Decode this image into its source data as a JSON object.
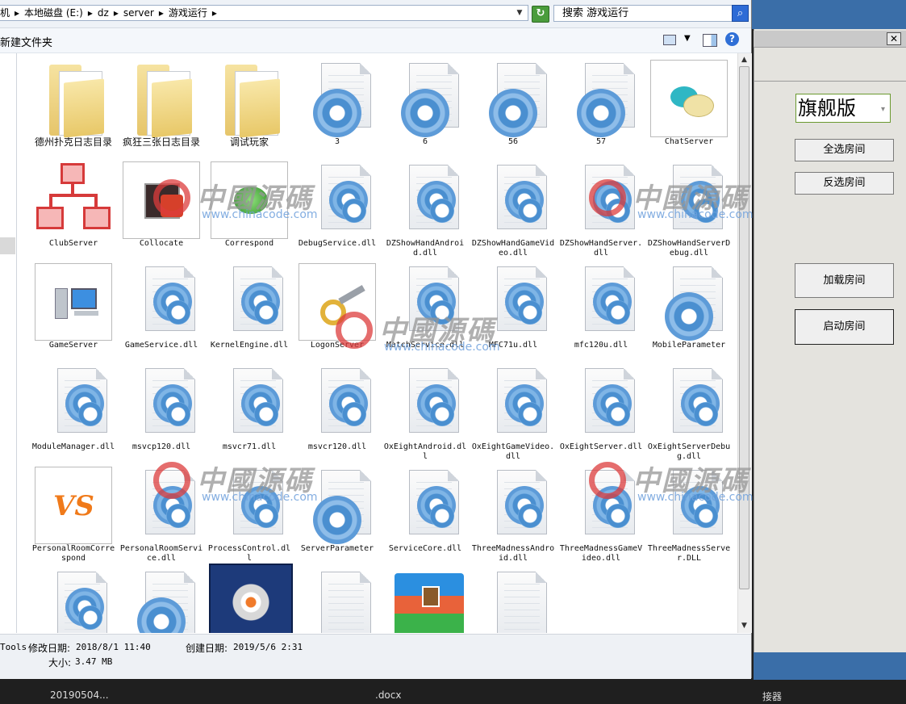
{
  "address_bar": {
    "segments": [
      "机",
      "▸",
      "本地磁盘 (E:)",
      "▸",
      "dz",
      "▸",
      "server",
      "▸",
      "游戏运行",
      "▸"
    ],
    "search_placeholder": "搜索 游戏运行"
  },
  "toolbar": {
    "new_folder_label": "新建文件夹"
  },
  "files": [
    {
      "name": "德州扑克日志目录",
      "type": "folder"
    },
    {
      "name": "疯狂三张日志目录",
      "type": "folder"
    },
    {
      "name": "调试玩家",
      "type": "folder"
    },
    {
      "name": "3",
      "type": "config"
    },
    {
      "name": "6",
      "type": "config"
    },
    {
      "name": "56",
      "type": "config"
    },
    {
      "name": "57",
      "type": "config"
    },
    {
      "name": "ChatServer",
      "type": "chat"
    },
    {
      "name": "ClubServer",
      "type": "network"
    },
    {
      "name": "Collocate",
      "type": "exe-red"
    },
    {
      "name": "Correspond",
      "type": "exe-green"
    },
    {
      "name": "DebugService.dll",
      "type": "dll"
    },
    {
      "name": "DZShowHandAndroid.dll",
      "type": "dll"
    },
    {
      "name": "DZShowHandGameVideo.dll",
      "type": "dll"
    },
    {
      "name": "DZShowHandServer.dll",
      "type": "dll"
    },
    {
      "name": "DZShowHandServerDebug.dll",
      "type": "dll"
    },
    {
      "name": "GameServer",
      "type": "exe-computer"
    },
    {
      "name": "GameService.dll",
      "type": "dll"
    },
    {
      "name": "KernelEngine.dll",
      "type": "dll"
    },
    {
      "name": "LogonServer",
      "type": "exe-key"
    },
    {
      "name": "MatchService.dll",
      "type": "dll"
    },
    {
      "name": "MFC71u.dll",
      "type": "dll"
    },
    {
      "name": "mfc120u.dll",
      "type": "dll"
    },
    {
      "name": "MobileParameter",
      "type": "config"
    },
    {
      "name": "ModuleManager.dll",
      "type": "dll"
    },
    {
      "name": "msvcp120.dll",
      "type": "dll"
    },
    {
      "name": "msvcr71.dll",
      "type": "dll"
    },
    {
      "name": "msvcr120.dll",
      "type": "dll"
    },
    {
      "name": "OxEightAndroid.dll",
      "type": "dll"
    },
    {
      "name": "OxEightGameVideo.dll",
      "type": "dll"
    },
    {
      "name": "OxEightServer.dll",
      "type": "dll"
    },
    {
      "name": "OxEightServerDebug.dll",
      "type": "dll"
    },
    {
      "name": "PersonalRoomCorrespond",
      "type": "exe-vs"
    },
    {
      "name": "PersonalRoomService.dll",
      "type": "dll"
    },
    {
      "name": "ProcessControl.dll",
      "type": "dll"
    },
    {
      "name": "ServerParameter",
      "type": "config"
    },
    {
      "name": "ServiceCore.dll",
      "type": "dll"
    },
    {
      "name": "ThreeMadnessAndroid.dll",
      "type": "dll"
    },
    {
      "name": "ThreeMadnessGameVideo.dll",
      "type": "dll"
    },
    {
      "name": "ThreeMadnessServer.DLL",
      "type": "dll"
    },
    {
      "name": "",
      "type": "dll"
    },
    {
      "name": "",
      "type": "config"
    },
    {
      "name": "",
      "type": "exe-blue-gear"
    },
    {
      "name": "",
      "type": "blank"
    },
    {
      "name": "",
      "type": "archive"
    },
    {
      "name": "",
      "type": "blank"
    }
  ],
  "status": {
    "name_fragment": "Tools",
    "modified_label": "修改日期:",
    "modified_value": "2018/8/1 11:40",
    "created_label": "创建日期:",
    "created_value": "2019/5/6 2:31",
    "size_label": "大小:",
    "size_value": "3.47 MB"
  },
  "side_panel": {
    "edition": "旗舰版",
    "select_all": "全选房间",
    "invert_select": "反选房间",
    "load_room": "加载房间",
    "start_room": "启动房间",
    "close_glyph": "✕"
  },
  "watermark": {
    "text": "中國源碼",
    "url": "www.chinacode.com"
  },
  "taskbar": {
    "left": "20190504...",
    "middle": ".docx",
    "right": "接器"
  },
  "colors": {
    "side_panel_bg": "#e4e3de",
    "accent_blue": "#3a6ea8",
    "watermark_red": "#dc3c3c"
  }
}
